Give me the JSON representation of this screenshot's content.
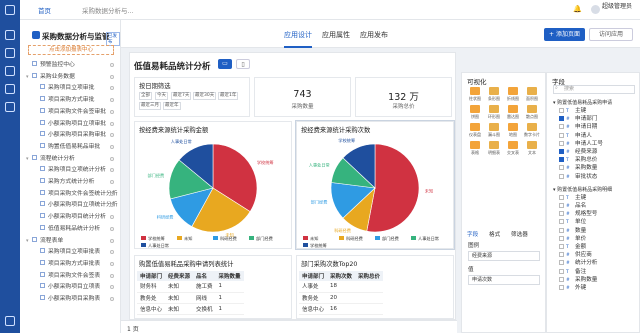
{
  "topbar": {
    "home": "首页",
    "breadcrumb": "采购数据分析与...",
    "user": "超级管理员"
  },
  "sidebar": {
    "title": "采购数据分析与监管",
    "badge": "已发布",
    "new_button": "点击添加报表中心",
    "items": [
      {
        "label": "预警监控中心",
        "level": 0,
        "tw": ""
      },
      {
        "label": "采购业务数据",
        "level": 0,
        "tw": "▾"
      },
      {
        "label": "采购项目立项审批",
        "level": 1,
        "tw": ""
      },
      {
        "label": "项目采购方式审批",
        "level": 1,
        "tw": ""
      },
      {
        "label": "项目采购文件会签审批",
        "level": 1,
        "tw": ""
      },
      {
        "label": "小额采购项目立项审批",
        "level": 1,
        "tw": ""
      },
      {
        "label": "小额采购项目采购审批",
        "level": 1,
        "tw": ""
      },
      {
        "label": "购置低值易耗品审批",
        "level": 1,
        "tw": ""
      },
      {
        "label": "流程统计分析",
        "level": 0,
        "tw": "▾"
      },
      {
        "label": "采购项目立项统计分析",
        "level": 1,
        "tw": ""
      },
      {
        "label": "采购方式统计分析",
        "level": 1,
        "tw": ""
      },
      {
        "label": "项目采购文件会签统计分析",
        "level": 1,
        "tw": ""
      },
      {
        "label": "小额采购项目立项统计分析",
        "level": 1,
        "tw": ""
      },
      {
        "label": "小额采购项目统计分析",
        "level": 1,
        "tw": ""
      },
      {
        "label": "低值易耗品统计分析",
        "level": 1,
        "tw": ""
      },
      {
        "label": "流程表单",
        "level": 0,
        "tw": "▾"
      },
      {
        "label": "采购项目立项审批表",
        "level": 1,
        "tw": ""
      },
      {
        "label": "项目采购方式审批表",
        "level": 1,
        "tw": ""
      },
      {
        "label": "项目采购文件会签表",
        "level": 1,
        "tw": ""
      },
      {
        "label": "小额采购项目立项表",
        "level": 1,
        "tw": ""
      },
      {
        "label": "小额采购项目采购表",
        "level": 1,
        "tw": ""
      }
    ]
  },
  "tabs": [
    "应用设计",
    "应用属性",
    "应用发布"
  ],
  "actions": {
    "add_page": "+ 添加页面",
    "visit_app": "访问应用"
  },
  "report": {
    "title": "低值易耗品统计分析",
    "filter": {
      "title": "按日期筛选",
      "chips": [
        "全部",
        "今天",
        "最近7天",
        "最近30天",
        "最近1年",
        "最近三月",
        "最近年"
      ]
    },
    "kpis": [
      {
        "value": "743",
        "label": "采购数量"
      },
      {
        "value": "132 万",
        "label": "采购总价"
      }
    ],
    "table1": {
      "title": "购置低值易耗品采购申请列表统计",
      "headers": [
        "申请部门",
        "经费来源",
        "品名",
        "采购数量"
      ],
      "rows": [
        [
          "财务科",
          "未知",
          "施工费",
          "1"
        ],
        [
          "教务处",
          "未知",
          "网线",
          "1"
        ],
        [
          "信息中心",
          "未知",
          "交换机",
          "1"
        ]
      ]
    },
    "table2": {
      "title": "部门采购次数Top20",
      "headers": [
        "申请部门",
        "采购次数",
        "采购总价"
      ],
      "rows": [
        [
          "人事处",
          "18",
          ""
        ],
        [
          "教务处",
          "20",
          ""
        ],
        [
          "信息中心",
          "16",
          ""
        ]
      ]
    },
    "pager": {
      "page": "1",
      "unit": "页"
    }
  },
  "chart_data": [
    {
      "type": "pie",
      "title": "按经费来源统计采购金额",
      "categories": [
        "学校统筹",
        "未知",
        "科研经费",
        "部门经费",
        "人事处日常"
      ],
      "values": [
        34,
        24,
        13,
        15,
        14
      ],
      "colors": [
        "#d03241",
        "#e8a820",
        "#2f9be3",
        "#36b37e",
        "#1f4f9e"
      ]
    },
    {
      "type": "pie",
      "title": "按经费来源统计采购次数",
      "categories": [
        "未知",
        "科研经费",
        "部门经费",
        "人事处日常",
        "学校统筹"
      ],
      "values": [
        53,
        10,
        14,
        10,
        13
      ],
      "colors": [
        "#d03241",
        "#e8a820",
        "#2f9be3",
        "#36b37e",
        "#1f4f9e"
      ]
    }
  ],
  "viz_panel": {
    "title": "可视化",
    "items": [
      "柱状图",
      "条形图",
      "折线图",
      "面积图",
      "饼图",
      "环形图",
      "雷达图",
      "散点图",
      "仪表盘",
      "漏斗图",
      "地图",
      "数字卡片",
      "表格",
      "明细表",
      "交叉表",
      "文本"
    ],
    "tabs": [
      "字段",
      "格式",
      "筛选器"
    ],
    "dim_label": "图例",
    "dim_value": "经费来源",
    "val_label": "值",
    "val_value": "申请次数"
  },
  "field_panel": {
    "title": "字段",
    "search": "搜索",
    "groups": [
      {
        "label": "购置低值易耗品采购申请",
        "fields": [
          "主键",
          "申请部门",
          "申请日期",
          "申请人",
          "申请人工号",
          "经费来源",
          "采购总价",
          "采购数量",
          "审批状态"
        ],
        "checked": [
          1,
          5,
          6
        ]
      },
      {
        "label": "购置低值易耗品采购明细",
        "fields": [
          "主键",
          "品名",
          "规格型号",
          "单位",
          "数量",
          "单价",
          "金额",
          "供应商",
          "统计分析",
          "备注",
          "采购数量",
          "外键"
        ],
        "checked": []
      }
    ]
  }
}
